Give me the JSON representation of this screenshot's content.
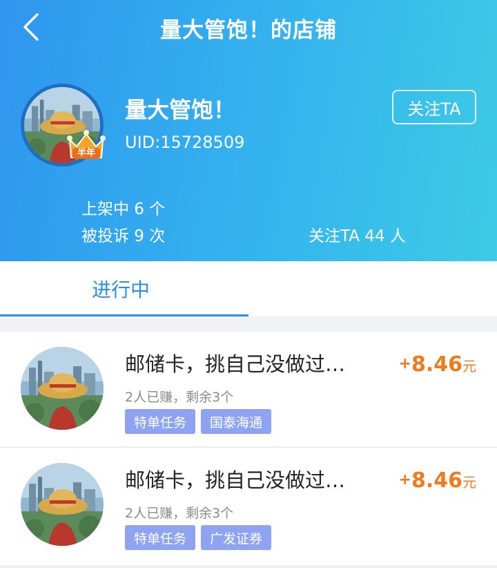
{
  "header": {
    "title": "量大管饱！的店铺",
    "back_icon": "chevron-left-icon"
  },
  "shop": {
    "name": "量大管饱！",
    "uid": "UID:15728509",
    "badge": "半年",
    "follow_label": "关注TA",
    "stats": {
      "listing": "上架中 6 个",
      "complaints": "被投诉 9 次",
      "followers": "关注TA 44 人"
    }
  },
  "tabs": [
    {
      "label": "进行中",
      "active": true
    }
  ],
  "tasks": [
    {
      "title": "邮储卡，挑自己没做过…",
      "reward_plus": "+",
      "reward_amount": "8.46",
      "reward_unit": "元",
      "meta": "2人已赚，剩余3个",
      "tags": [
        "特单任务",
        "国泰海通"
      ]
    },
    {
      "title": "邮储卡，挑自己没做过…",
      "reward_plus": "+",
      "reward_amount": "8.46",
      "reward_unit": "元",
      "meta": "2人已赚，剩余3个",
      "tags": [
        "特单任务",
        "广发证券"
      ]
    }
  ],
  "colors": {
    "header_start": "#2f96ee",
    "header_end": "#3dcbe6",
    "accent": "#2a8fe6",
    "reward": "#f07a1c",
    "tag": "#8ea4f3"
  }
}
